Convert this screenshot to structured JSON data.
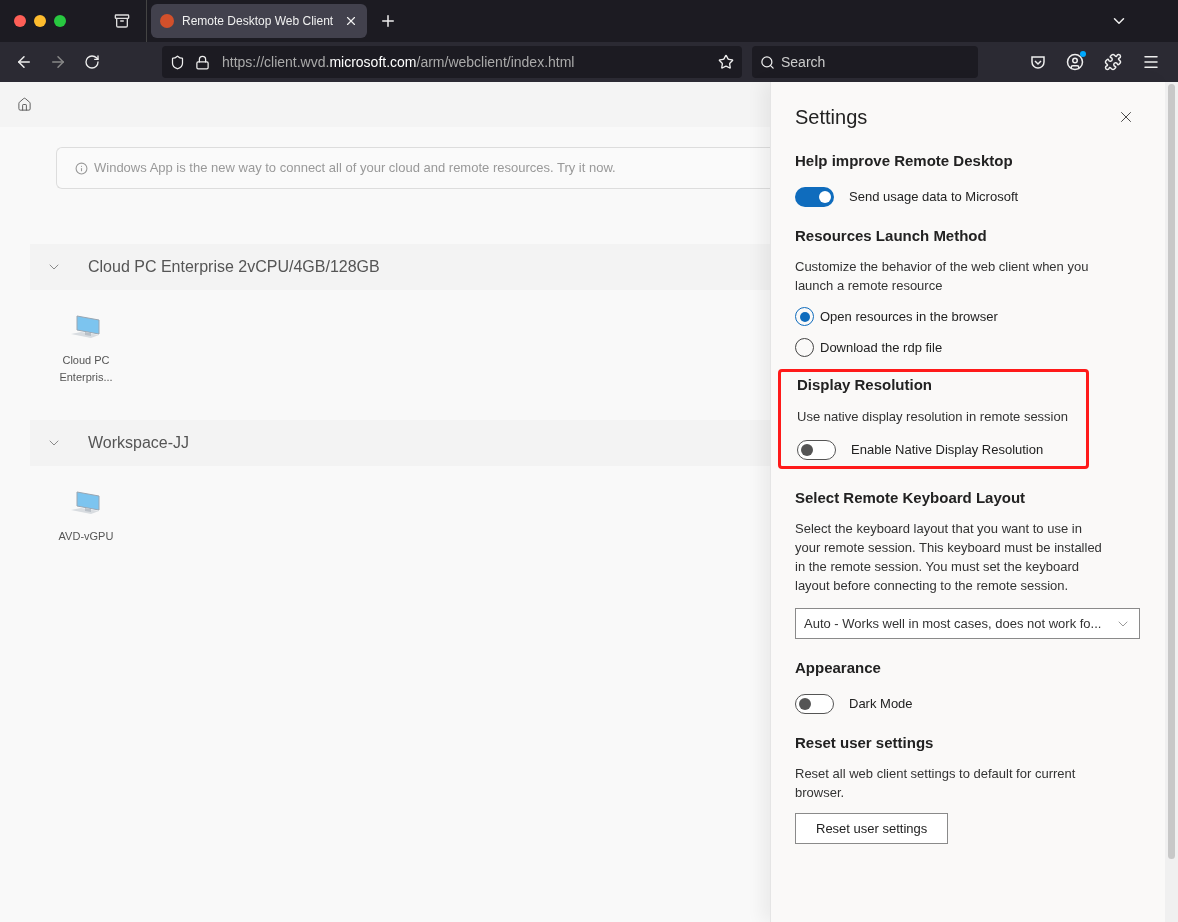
{
  "browser": {
    "tab": {
      "title": "Remote Desktop Web Client",
      "selected": true
    },
    "url_parts": [
      {
        "text": "https://client.wvd.",
        "emphasis": false
      },
      {
        "text": "microsoft.com",
        "emphasis": true
      },
      {
        "text": "/arm/webclient/index.html",
        "emphasis": false
      }
    ],
    "search": {
      "placeholder": "Search"
    }
  },
  "page": {
    "banner": "Windows App is the new way to connect all of your cloud and remote resources. Try it now.",
    "groups": [
      {
        "title": "Cloud PC Enterprise 2vCPU/4GB/128GB",
        "expanded": true,
        "resources": [
          {
            "name": "Cloud PC Enterpris..."
          }
        ]
      },
      {
        "title": "Workspace-JJ",
        "expanded": true,
        "resources": [
          {
            "name": "AVD-vGPU"
          }
        ]
      }
    ]
  },
  "settings": {
    "title": "Settings",
    "sections": [
      {
        "kind": "toggle",
        "heading": "Help improve Remote Desktop",
        "highlighted": false,
        "toggle": {
          "label": "Send usage data to Microsoft",
          "on": true
        }
      },
      {
        "kind": "radio",
        "heading": "Resources Launch Method",
        "highlighted": false,
        "description": "Customize the behavior of the web client when you launch a remote resource",
        "options": [
          {
            "label": "Open resources in the browser",
            "selected": true
          },
          {
            "label": "Download the rdp file",
            "selected": false
          }
        ]
      },
      {
        "kind": "toggle",
        "heading": "Display Resolution",
        "highlighted": true,
        "description": "Use native display resolution in remote session",
        "toggle": {
          "label": "Enable Native Display Resolution",
          "on": false
        }
      },
      {
        "kind": "select",
        "heading": "Select Remote Keyboard Layout",
        "highlighted": false,
        "description": "Select the keyboard layout that you want to use in your remote session. This keyboard must be installed in the remote session. You must set the keyboard layout before connecting to the remote session.",
        "value": "Auto - Works well in most cases, does not work fo..."
      },
      {
        "kind": "toggle",
        "heading": "Appearance",
        "highlighted": false,
        "toggle": {
          "label": "Dark Mode",
          "on": false
        }
      },
      {
        "kind": "button",
        "heading": "Reset user settings",
        "highlighted": false,
        "description": "Reset all web client settings to default for current browser.",
        "button": "Reset user settings"
      }
    ]
  }
}
